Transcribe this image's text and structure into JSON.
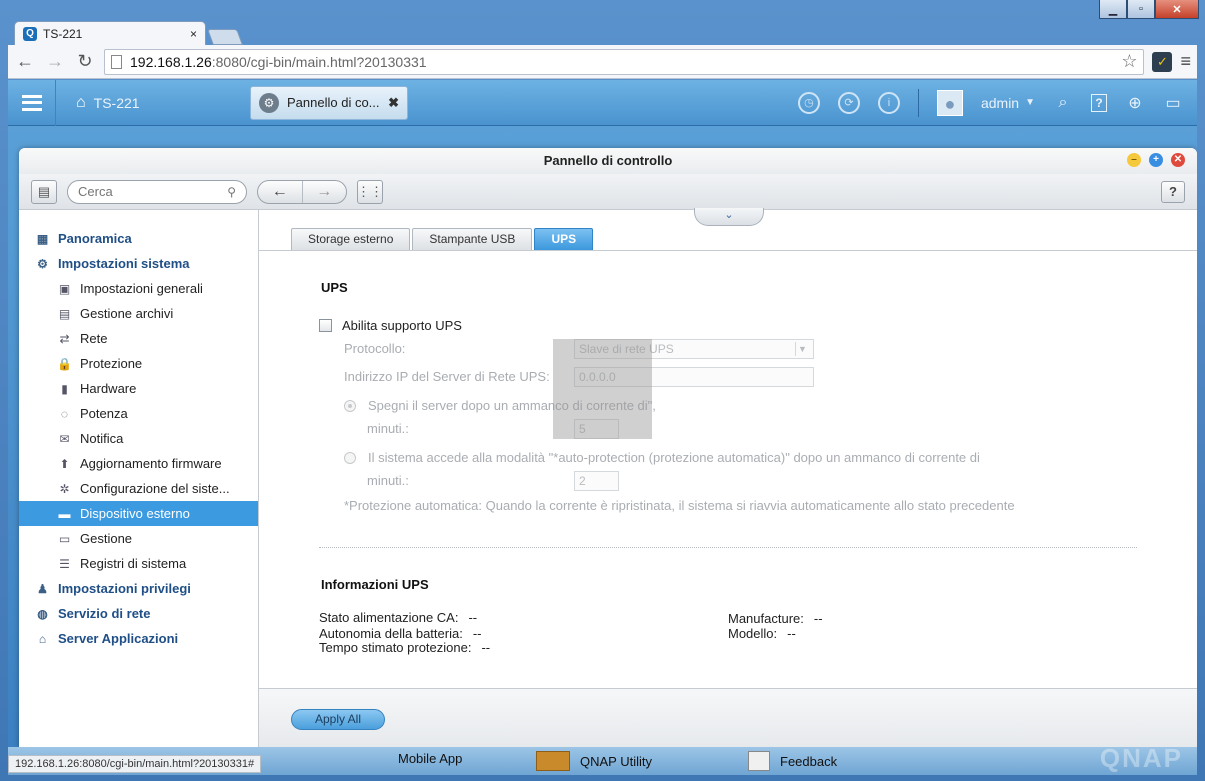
{
  "browser": {
    "tab_title": "TS-221",
    "url_host": "192.168.1.26",
    "url_path": ":8080/cgi-bin/main.html?20130331",
    "status_url": "192.168.1.26:8080/cgi-bin/main.html?20130331#"
  },
  "topbar": {
    "device_name": "TS-221",
    "open_app": "Pannello di co...",
    "user": "admin"
  },
  "window": {
    "title": "Pannello di controllo",
    "search_placeholder": "Cerca"
  },
  "sidebar": {
    "items": [
      {
        "label": "Panoramica",
        "level": "top",
        "icon": "overview-icon"
      },
      {
        "label": "Impostazioni sistema",
        "level": "top",
        "icon": "gear-icon"
      },
      {
        "label": "Impostazioni generali",
        "level": "sub",
        "icon": "general-settings-icon"
      },
      {
        "label": "Gestione archivi",
        "level": "sub",
        "icon": "storage-icon"
      },
      {
        "label": "Rete",
        "level": "sub",
        "icon": "network-icon"
      },
      {
        "label": "Protezione",
        "level": "sub",
        "icon": "lock-icon"
      },
      {
        "label": "Hardware",
        "level": "sub",
        "icon": "hardware-icon"
      },
      {
        "label": "Potenza",
        "level": "sub",
        "icon": "bulb-icon"
      },
      {
        "label": "Notifica",
        "level": "sub",
        "icon": "notification-icon"
      },
      {
        "label": "Aggiornamento firmware",
        "level": "sub",
        "icon": "firmware-icon"
      },
      {
        "label": "Configurazione del siste...",
        "level": "sub",
        "icon": "config-icon"
      },
      {
        "label": "Dispositivo esterno",
        "level": "sub",
        "icon": "external-device-icon",
        "active": true
      },
      {
        "label": "Gestione",
        "level": "sub",
        "icon": "monitor-icon"
      },
      {
        "label": "Registri di sistema",
        "level": "sub",
        "icon": "log-icon"
      },
      {
        "label": "Impostazioni privilegi",
        "level": "top",
        "icon": "user-icon"
      },
      {
        "label": "Servizio di rete",
        "level": "top",
        "icon": "network-service-icon"
      },
      {
        "label": "Server Applicazioni",
        "level": "top",
        "icon": "app-server-icon"
      }
    ]
  },
  "tabs": [
    "Storage esterno",
    "Stampante USB",
    "UPS"
  ],
  "ups": {
    "section_title": "UPS",
    "enable_label": "Abilita supporto UPS",
    "protocol_label": "Protocollo:",
    "protocol_value": "Slave di rete UPS",
    "ip_label": "Indirizzo IP del Server di Rete UPS:",
    "ip_value": "0.0.0.0",
    "opt1_label": "Spegni il server dopo un ammanco di corrente di\",",
    "opt1_minutes_label": "minuti.:",
    "opt1_minutes": "5",
    "opt2_label": "Il sistema accede alla modalità \"*auto-protection (protezione automatica)\" dopo un ammanco di corrente di",
    "opt2_minutes_label": "minuti.:",
    "opt2_minutes": "2",
    "note": "*Protezione automatica: Quando la corrente è ripristinata, il sistema si riavvia automaticamente allo stato precedente"
  },
  "info": {
    "section_title": "Informazioni UPS",
    "ac_label": "Stato alimentazione CA:",
    "ac_value": "--",
    "battery_label": "Autonomia della batteria:",
    "battery_value": "--",
    "time_label": "Tempo stimato protezione:",
    "time_value": "--",
    "manufacturer_label": "Manufacture:",
    "manufacturer_value": "--",
    "model_label": "Modello:",
    "model_value": "--"
  },
  "footer": {
    "apply_label": "Apply All"
  },
  "dock": {
    "mobile_app": "Mobile App",
    "utility": "QNAP Utility",
    "feedback": "Feedback",
    "brand": "QNAP"
  }
}
